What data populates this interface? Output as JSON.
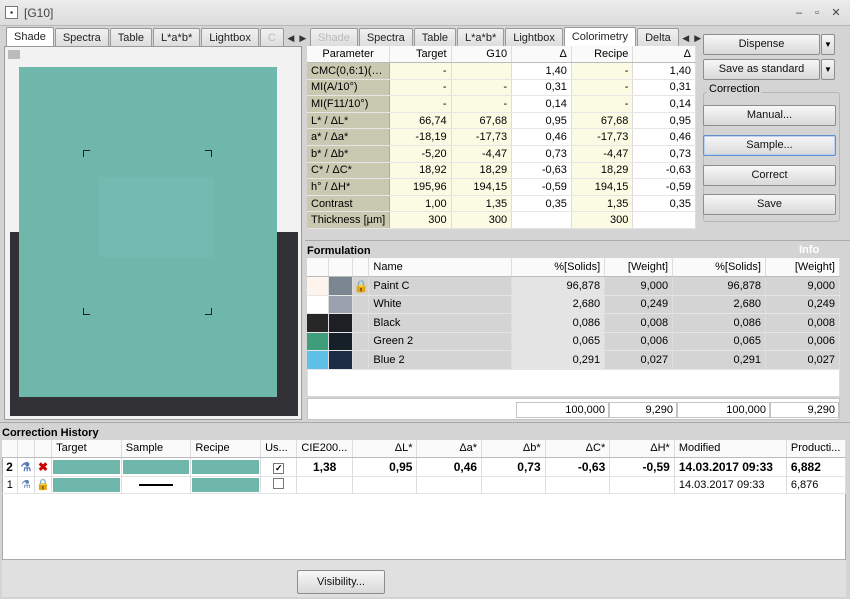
{
  "window": {
    "title": "[G10]"
  },
  "left_tabs": [
    "Shade",
    "Spectra",
    "Table",
    "L*a*b*",
    "Lightbox",
    "C"
  ],
  "right_tabs": [
    "Shade",
    "Spectra",
    "Table",
    "L*a*b*",
    "Lightbox",
    "Colorimetry",
    "Delta"
  ],
  "colorimetry": {
    "headers": [
      "Parameter",
      "Target",
      "G10",
      "Δ",
      "Recipe",
      "Δ"
    ],
    "rows": [
      [
        "CMC(0,6:1)(…",
        "-",
        "",
        "1,40",
        "-",
        "1,40"
      ],
      [
        "MI(A/10°)",
        "-",
        "-",
        "0,31",
        "-",
        "0,31"
      ],
      [
        "MI(F11/10°)",
        "-",
        "-",
        "0,14",
        "-",
        "0,14"
      ],
      [
        "L* / ΔL*",
        "66,74",
        "67,68",
        "0,95",
        "67,68",
        "0,95"
      ],
      [
        "a* / Δa*",
        "-18,19",
        "-17,73",
        "0,46",
        "-17,73",
        "0,46"
      ],
      [
        "b* / Δb*",
        "-5,20",
        "-4,47",
        "0,73",
        "-4,47",
        "0,73"
      ],
      [
        "C* / ΔC*",
        "18,92",
        "18,29",
        "-0,63",
        "18,29",
        "-0,63"
      ],
      [
        "h° / ΔH*",
        "195,96",
        "194,15",
        "-0,59",
        "194,15",
        "-0,59"
      ],
      [
        "Contrast",
        "1,00",
        "1,35",
        "0,35",
        "1,35",
        "0,35"
      ],
      [
        "Thickness [µm]",
        "300",
        "300",
        "",
        "300",
        ""
      ]
    ]
  },
  "buttons": {
    "dispense": "Dispense",
    "save_as_standard": "Save as standard",
    "correction_group": "Correction",
    "manual": "Manual...",
    "sample": "Sample...",
    "correct": "Correct",
    "save": "Save",
    "visibility": "Visibility..."
  },
  "formulation": {
    "title": "Formulation",
    "info_label": "Info",
    "headers": [
      "Name",
      "%[Solids]",
      "[Weight]",
      "%[Solids]",
      "[Weight]"
    ],
    "rows": [
      {
        "name": "Paint C",
        "locked": true,
        "c1": "#fdf4ee",
        "c2": "#7c8690",
        "v": [
          "96,878",
          "9,000",
          "96,878",
          "9,000"
        ]
      },
      {
        "name": "White",
        "locked": false,
        "c1": "#ffffff",
        "c2": "#9aa3ad",
        "v": [
          "2,680",
          "0,249",
          "2,680",
          "0,249"
        ]
      },
      {
        "name": "Black",
        "locked": false,
        "c1": "#272727",
        "c2": "#1d1f24",
        "v": [
          "0,086",
          "0,008",
          "0,086",
          "0,008"
        ]
      },
      {
        "name": "Green 2",
        "locked": false,
        "c1": "#3d9e79",
        "c2": "#162028",
        "v": [
          "0,065",
          "0,006",
          "0,065",
          "0,006"
        ]
      },
      {
        "name": "Blue 2",
        "locked": false,
        "c1": "#5ec0e8",
        "c2": "#1b2c44",
        "v": [
          "0,291",
          "0,027",
          "0,291",
          "0,027"
        ]
      }
    ],
    "totals": [
      "100,000",
      "9,290",
      "100,000",
      "9,290"
    ]
  },
  "history": {
    "title": "Correction History",
    "headers": [
      "",
      "",
      "",
      "Target",
      "Sample",
      "Recipe",
      "Us...",
      "CIE200...",
      "ΔL*",
      "Δa*",
      "Δb*",
      "ΔC*",
      "ΔH*",
      "Modified",
      "Producti..."
    ],
    "rows": [
      {
        "num": "2",
        "checked": true,
        "v": [
          "1,38",
          "0,95",
          "0,46",
          "0,73",
          "-0,63",
          "-0,59"
        ],
        "modified": "14.03.2017 09:33",
        "production": "6,882"
      },
      {
        "num": "1",
        "checked": false,
        "v": [
          "",
          "",
          "",
          "",
          "",
          ""
        ],
        "modified": "14.03.2017 09:33",
        "production": "6,876"
      }
    ]
  }
}
